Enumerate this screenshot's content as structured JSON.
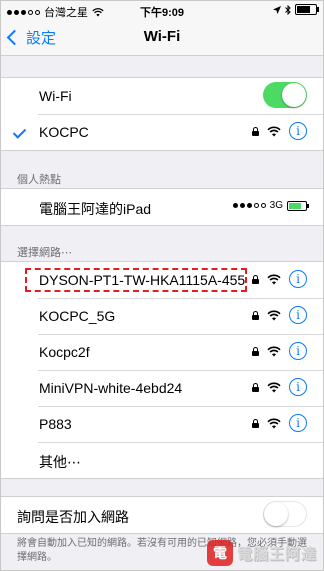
{
  "statusbar": {
    "carrier": "台灣之星",
    "time": "下午9:09",
    "network_type": "3G",
    "battery_level": 0.75
  },
  "nav": {
    "back_label": "設定",
    "title": "Wi-Fi"
  },
  "wifi": {
    "label": "Wi-Fi",
    "enabled": true,
    "connected_network": "KOCPC"
  },
  "hotspot": {
    "header": "個人熱點",
    "device_name": "電腦王阿達的iPad",
    "network_type": "3G",
    "signal_bars_filled": 3,
    "signal_bars_total": 5,
    "battery_level": 0.8
  },
  "networks": {
    "header": "選擇網路⋯",
    "items": [
      {
        "name": "DYSON-PT1-TW-HKA1115A-455",
        "secured": true,
        "highlighted": true
      },
      {
        "name": "KOCPC_5G",
        "secured": true,
        "highlighted": false
      },
      {
        "name": "Kocpc2f",
        "secured": true,
        "highlighted": false
      },
      {
        "name": "MiniVPN-white-4ebd24",
        "secured": true,
        "highlighted": false
      },
      {
        "name": "P883",
        "secured": true,
        "highlighted": false
      }
    ],
    "other_label": "其他⋯"
  },
  "ask_join": {
    "label": "詢問是否加入網路",
    "enabled": false,
    "footer": "將會自動加入已知的網路。若沒有可用的已知網路，您必須手動選擇網路。"
  },
  "colors": {
    "accent": "#0a7aff",
    "toggle_on": "#4cd964",
    "highlight": "#e02020"
  },
  "watermark": {
    "badge": "電",
    "text": "電腦王阿達"
  }
}
